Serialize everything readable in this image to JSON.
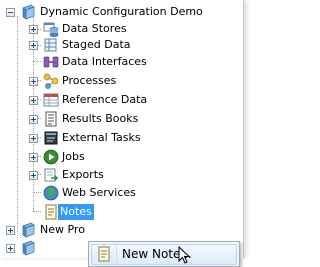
{
  "tree": {
    "root": {
      "label": "Dynamic Configuration Demo",
      "icon": "project-icon"
    },
    "items": [
      {
        "label": "Data Stores",
        "icon": "data-stores-icon",
        "expandable": true
      },
      {
        "label": "Staged Data",
        "icon": "staged-data-icon",
        "expandable": true
      },
      {
        "label": "Data Interfaces",
        "icon": "data-interfaces-icon",
        "expandable": false
      },
      {
        "label": "Processes",
        "icon": "processes-icon",
        "expandable": true
      },
      {
        "label": "Reference Data",
        "icon": "reference-data-icon",
        "expandable": true
      },
      {
        "label": "Results Books",
        "icon": "results-books-icon",
        "expandable": true
      },
      {
        "label": "External Tasks",
        "icon": "external-tasks-icon",
        "expandable": true
      },
      {
        "label": "Jobs",
        "icon": "jobs-icon",
        "expandable": true
      },
      {
        "label": "Exports",
        "icon": "exports-icon",
        "expandable": true
      },
      {
        "label": "Web Services",
        "icon": "web-services-icon",
        "expandable": false
      },
      {
        "label": "Notes",
        "icon": "notes-icon",
        "expandable": false,
        "selected": true
      }
    ],
    "siblings": [
      {
        "label": "New Pro",
        "icon": "project-icon"
      },
      {
        "label": "",
        "icon": "project-icon"
      }
    ]
  },
  "context_menu": {
    "items": [
      {
        "label": "New Note...",
        "icon": "note-icon"
      }
    ]
  },
  "colors": {
    "selection": "#3399ff",
    "menu_hover": "#dcebfc"
  }
}
